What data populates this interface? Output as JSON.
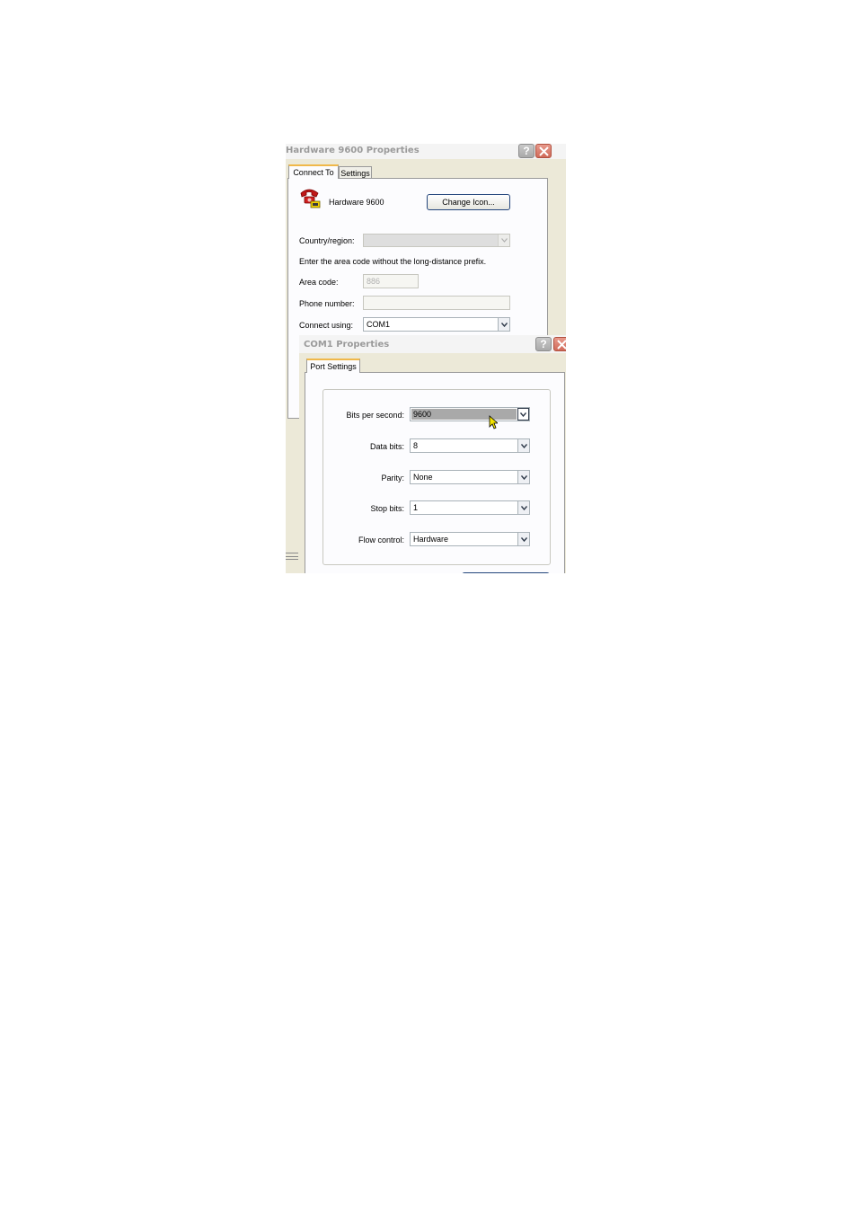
{
  "connection_dialog": {
    "title": "Hardware 9600 Properties",
    "help_glyph": "?",
    "tabs": [
      {
        "label": "Connect To",
        "active": true
      },
      {
        "label": "Settings",
        "active": false
      }
    ],
    "connection_name": "Hardware 9600",
    "connection_icon": "phone-icon",
    "change_icon_button": "Change Icon...",
    "country_label": "Country/region:",
    "country_value": "",
    "area_code_hint": "Enter the area code without the long-distance prefix.",
    "area_code_label": "Area code:",
    "area_code_value": "886",
    "phone_label": "Phone number:",
    "phone_value": "",
    "connect_using_label": "Connect using:",
    "connect_using_value": "COM1"
  },
  "port_dialog": {
    "title": "COM1 Properties",
    "help_glyph": "?",
    "tabs": [
      {
        "label": "Port Settings",
        "active": true
      }
    ],
    "fields": {
      "bits_per_second": {
        "label": "Bits per second:",
        "value": "9600"
      },
      "data_bits": {
        "label": "Data bits:",
        "value": "8"
      },
      "parity": {
        "label": "Parity:",
        "value": "None"
      },
      "stop_bits": {
        "label": "Stop bits:",
        "value": "1"
      },
      "flow_control": {
        "label": "Flow control:",
        "value": "Hardware"
      }
    }
  },
  "colors": {
    "tab_highlight": "#f0b84a",
    "close_button": "#d06a5a",
    "selection": "#a9a9a9",
    "cursor": "#f2e200"
  }
}
